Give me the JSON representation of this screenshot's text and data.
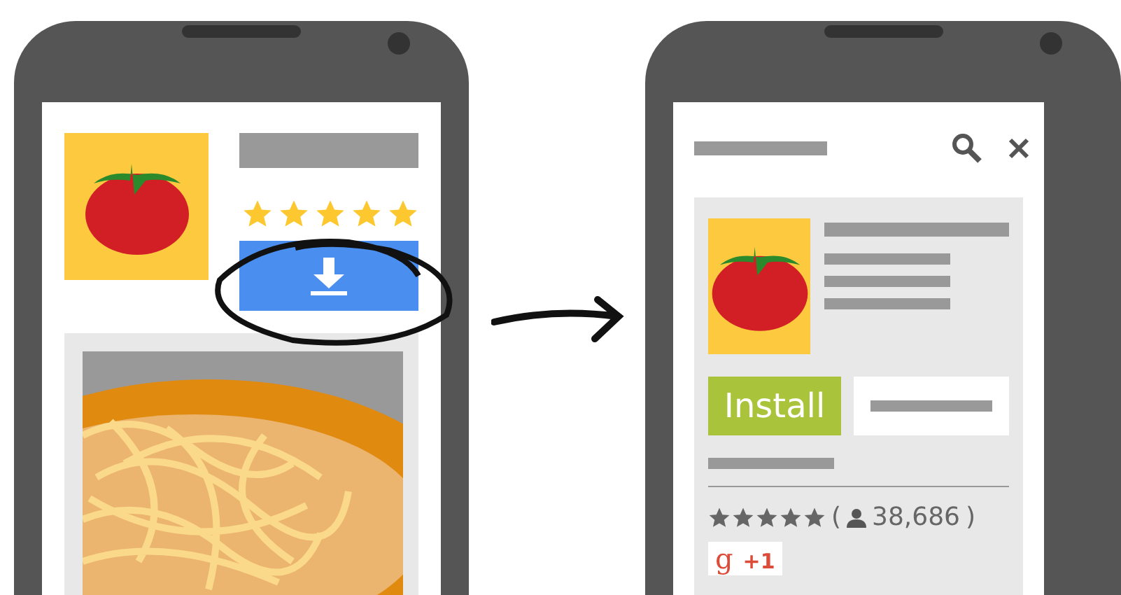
{
  "before_phone": {
    "stars": 5
  },
  "after_phone": {
    "install_button": "Install",
    "stars": 5,
    "open_paren": "(",
    "review_count": "38,686",
    "close_paren": ")",
    "plus_one": {
      "g": "g",
      "label": "+1"
    }
  }
}
